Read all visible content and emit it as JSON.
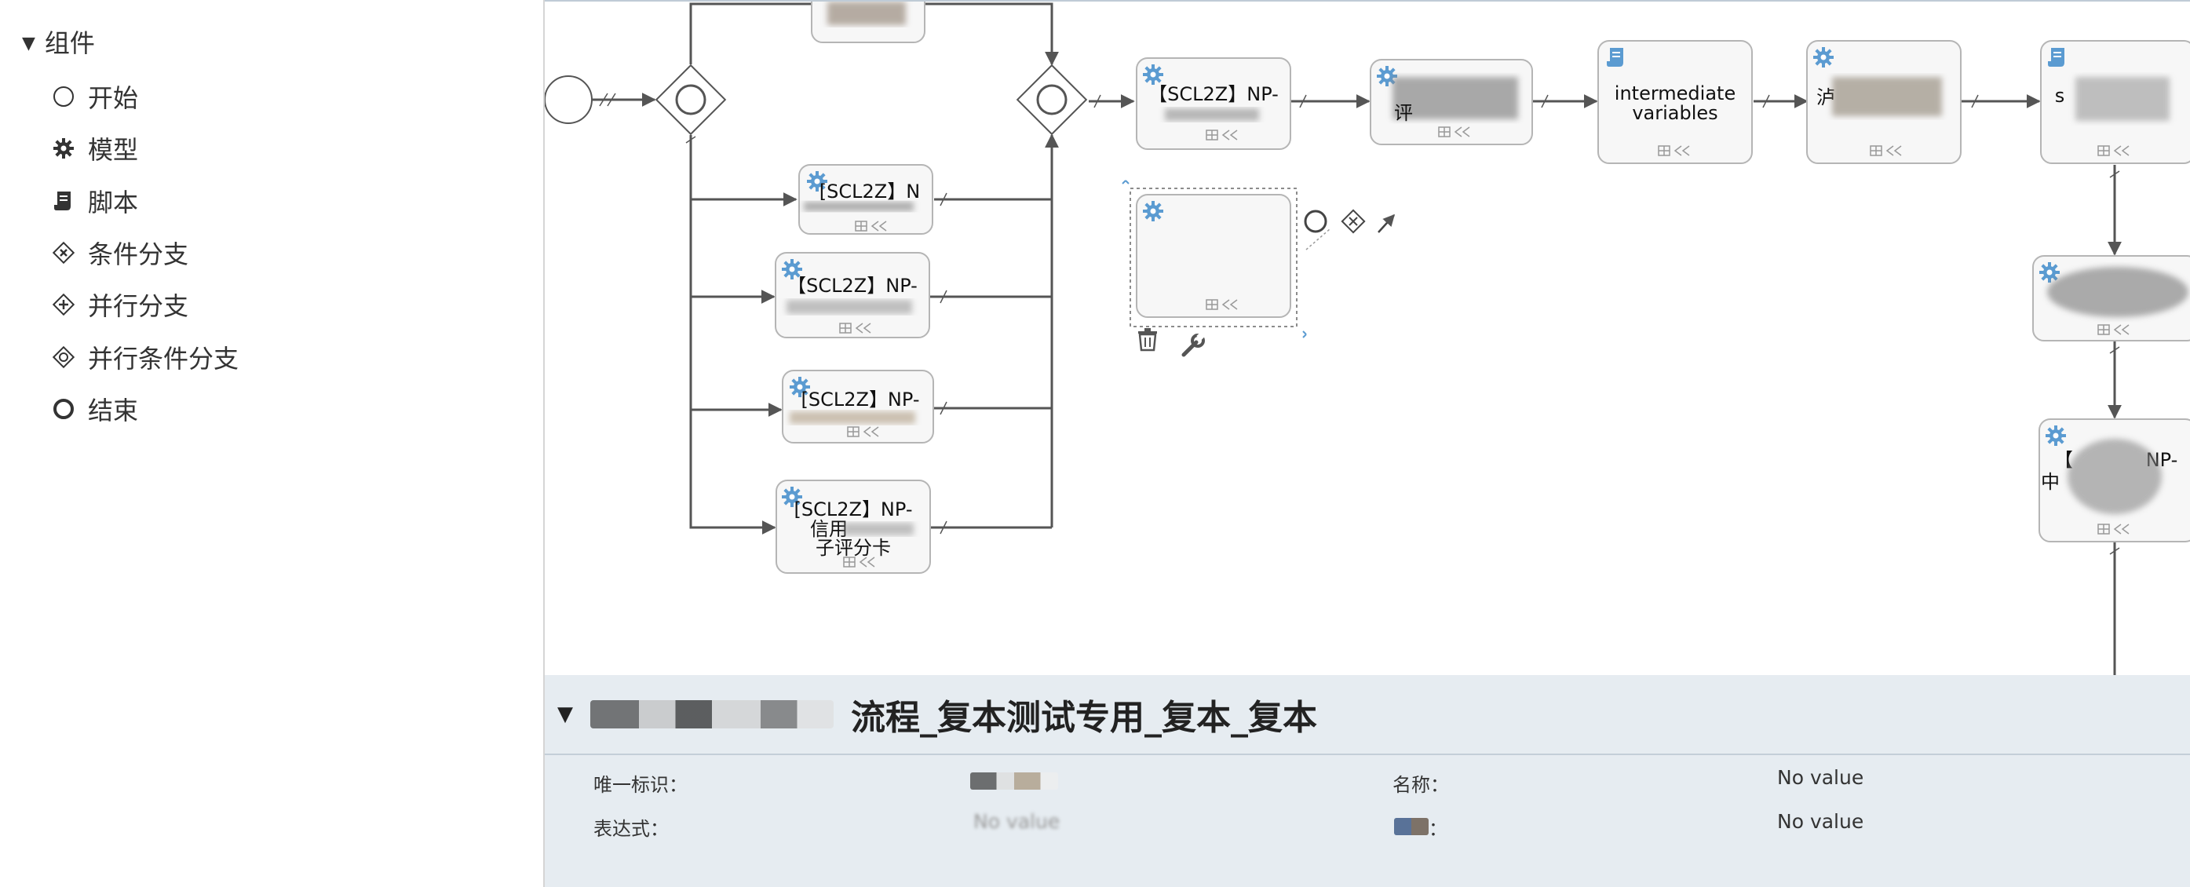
{
  "sidebar": {
    "header": "组件",
    "items": [
      {
        "label": "开始",
        "icon": "circle-outline-icon"
      },
      {
        "label": "模型",
        "icon": "gear-icon"
      },
      {
        "label": "脚本",
        "icon": "script-icon"
      },
      {
        "label": "条件分支",
        "icon": "diamond-x-icon"
      },
      {
        "label": "并行分支",
        "icon": "diamond-plus-icon"
      },
      {
        "label": "并行条件分支",
        "icon": "diamond-circle-icon"
      },
      {
        "label": "结束",
        "icon": "circle-thick-icon"
      }
    ]
  },
  "diagram": {
    "nodes": {
      "n_top": "",
      "n_b1": "[SCL2Z】N",
      "n_b2": "【SCL2Z】NP-",
      "n_b3": "[SCL2Z】NP-",
      "n_b4_l1": "[SCL2Z】NP-",
      "n_b4_l2": "信用",
      "n_b4_l3": "子评分卡",
      "m1": "【SCL2Z】NP-",
      "m2": "评",
      "m3_l1": "intermediate",
      "m3_l2": "variables",
      "m4": "泸",
      "m5": "s",
      "r2": "",
      "r3_l1": "【",
      "r3_l2": "中",
      "r3_l3": "NP-"
    }
  },
  "props": {
    "title": "流程_复本测试专用_复本_复本",
    "fields": [
      {
        "label": "唯一标识：",
        "value": ""
      },
      {
        "label": "名称：",
        "value": "No value"
      },
      {
        "label": "表达式：",
        "value": "No value"
      },
      {
        "label": "：",
        "value": "No value"
      }
    ]
  },
  "colors": {
    "accent_blue": "#5b9bd1",
    "edge": "#555555",
    "panel_bg": "#e6ecf1",
    "node_fill": "#f7f7f7",
    "node_stroke": "#b5b5b5"
  }
}
